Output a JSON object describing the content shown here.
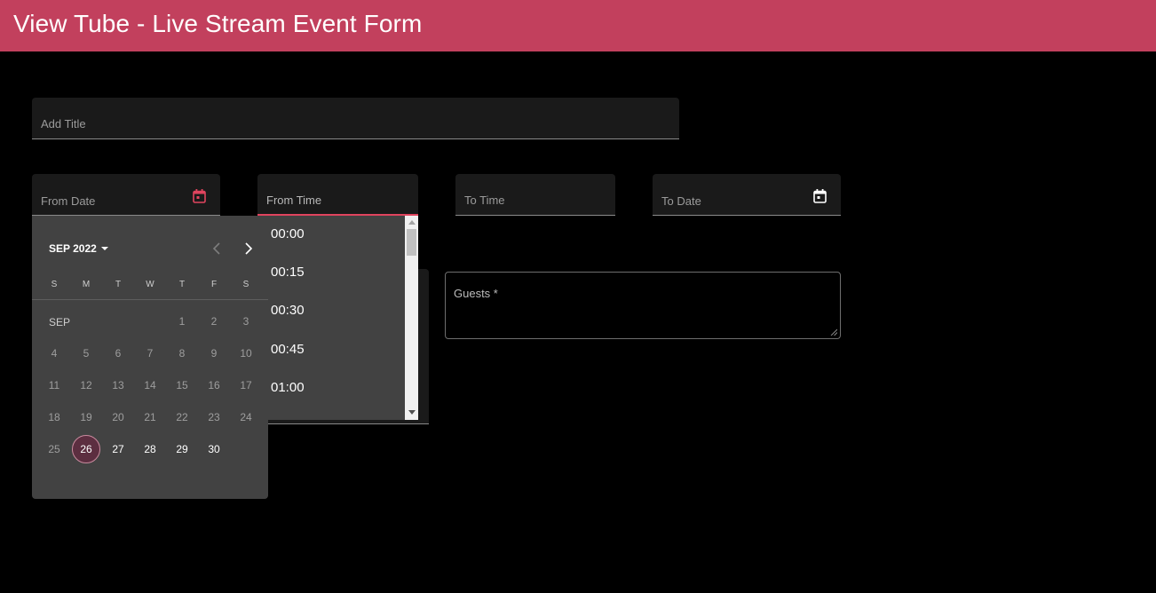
{
  "app": {
    "title": "View Tube - Live Stream Event Form"
  },
  "form": {
    "title_label": "Add Title",
    "from_date_label": "From Date",
    "from_time_label": "From Time",
    "to_time_label": "To Time",
    "to_date_label": "To Date",
    "guests_label": "Guests *"
  },
  "time_options": [
    "00:00",
    "00:15",
    "00:30",
    "00:45",
    "01:00"
  ],
  "datepicker": {
    "period_label": "SEP 2022",
    "month_label": "SEP",
    "weekdays": [
      "S",
      "M",
      "T",
      "W",
      "T",
      "F",
      "S"
    ],
    "days": [
      "1",
      "2",
      "3",
      "4",
      "5",
      "6",
      "7",
      "8",
      "9",
      "10",
      "11",
      "12",
      "13",
      "14",
      "15",
      "16",
      "17",
      "18",
      "19",
      "20",
      "21",
      "22",
      "23",
      "24",
      "25",
      "26",
      "27",
      "28",
      "29",
      "30"
    ],
    "today": "26"
  },
  "colors": {
    "app_bar": "#c2405d",
    "accent": "#e0445e",
    "panel": "#424242",
    "field": "#1a1a1a"
  }
}
